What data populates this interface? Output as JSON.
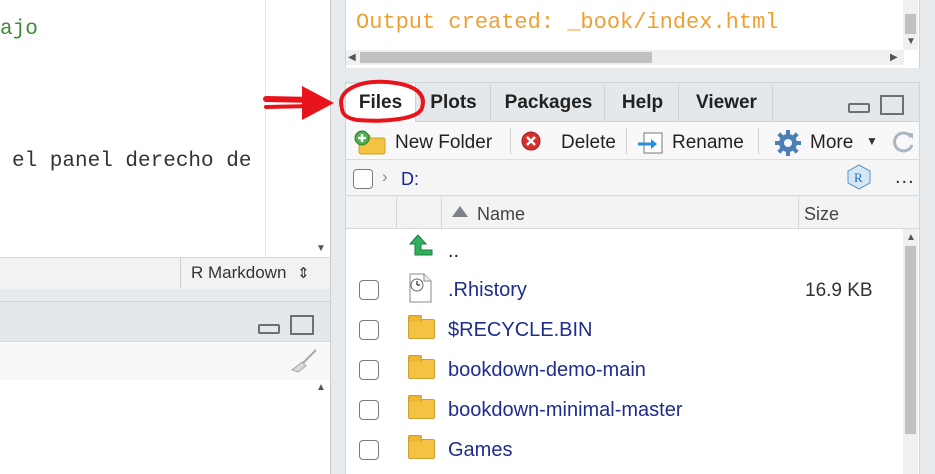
{
  "editor": {
    "line1_partial": "ajo",
    "line2_partial": " el panel derecho de",
    "document_type": "R Markdown",
    "document_type_arrows": "⇕"
  },
  "render_output": {
    "message": "Output created: _book/index.html"
  },
  "tabs": [
    {
      "label": "Files",
      "active": true
    },
    {
      "label": "Plots",
      "active": false
    },
    {
      "label": "Packages",
      "active": false
    },
    {
      "label": "Help",
      "active": false
    },
    {
      "label": "Viewer",
      "active": false
    }
  ],
  "toolbar": {
    "new_folder": "New Folder",
    "delete": "Delete",
    "rename": "Rename",
    "more": "More"
  },
  "path": {
    "drive": "D:",
    "more": "..."
  },
  "table": {
    "col_name": "Name",
    "col_size": "Size",
    "parent_label": "..",
    "rows": [
      {
        "name": ".Rhistory",
        "size": "16.9 KB",
        "type": "file"
      },
      {
        "name": "$RECYCLE.BIN",
        "size": "",
        "type": "folder"
      },
      {
        "name": "bookdown-demo-main",
        "size": "",
        "type": "folder"
      },
      {
        "name": "bookdown-minimal-master",
        "size": "",
        "type": "folder"
      },
      {
        "name": "Games",
        "size": "",
        "type": "folder"
      }
    ]
  },
  "annotation": {
    "color": "#e8141c"
  },
  "colors": {
    "output_text": "#f0a030",
    "file_link": "#1f2d8c",
    "editor_green": "#3d8a3d"
  }
}
